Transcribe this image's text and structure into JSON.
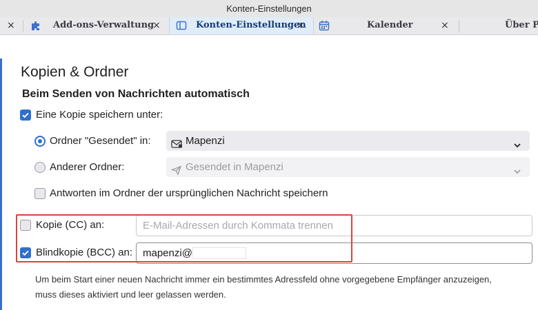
{
  "window": {
    "title": "Konten-Einstellungen"
  },
  "tabs": [
    {
      "label": "Add-ons-Verwaltung",
      "icon": "puzzle-icon"
    },
    {
      "label": "Konten-Einstellungen",
      "icon": "sidebar-icon",
      "active": true
    },
    {
      "label": "Kalender",
      "icon": "calendar-icon"
    },
    {
      "label": "Über Pr"
    }
  ],
  "tab_close_glyph": "×",
  "section": {
    "title": "Kopien & Ordner",
    "subtitle": "Beim Senden von Nachrichten automatisch"
  },
  "save_copy": {
    "label": "Eine Kopie speichern unter:",
    "checked": true
  },
  "sent_folder": {
    "label": "Ordner \"Gesendet\" in:",
    "selected": true,
    "value": "Mapenzi",
    "icon": "mail-account-icon"
  },
  "other_folder": {
    "label": "Anderer Ordner:",
    "selected": false,
    "value": "Gesendet in Mapenzi",
    "icon": "send-icon",
    "disabled": true
  },
  "reply_in_folder": {
    "label": "Antworten im Ordner der ursprünglichen Nachricht speichern",
    "checked": false
  },
  "cc": {
    "label": "Kopie (CC) an:",
    "checked": false,
    "placeholder": "E-Mail-Adressen durch Kommata trennen",
    "value": ""
  },
  "bcc": {
    "label": "Blindkopie (BCC) an:",
    "checked": true,
    "value": "mapenzi@"
  },
  "note": {
    "line1": "Um beim Start einer neuen Nachricht immer ein bestimmtes Adressfeld ohne vorgegebene Empfänger anzuzeigen,",
    "line2": "muss dieses aktiviert und leer gelassen werden."
  },
  "colors": {
    "accent": "#2f6fd0",
    "highlight": "#d8443a",
    "active_tab_bg": "#e0edf8"
  }
}
